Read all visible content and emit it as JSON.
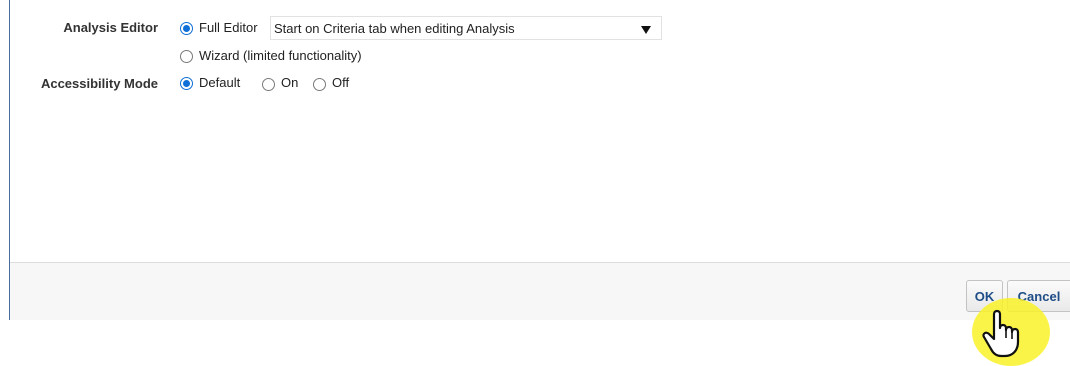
{
  "analysis_editor": {
    "label": "Analysis Editor",
    "options": [
      {
        "label": "Full Editor",
        "checked": true
      },
      {
        "label": "Wizard (limited functionality)",
        "checked": false
      }
    ],
    "start_tab_select": {
      "value": "Start on Criteria tab when editing Analysis"
    }
  },
  "accessibility_mode": {
    "label": "Accessibility Mode",
    "options": [
      {
        "label": "Default",
        "checked": true
      },
      {
        "label": "On",
        "checked": false
      },
      {
        "label": "Off",
        "checked": false
      }
    ]
  },
  "footer": {
    "ok_label": "OK",
    "cancel_label": "Cancel"
  },
  "colors": {
    "radio_selected": "#0e6fd6",
    "button_text": "#1f4d87",
    "dialog_border": "#4a6da0",
    "click_highlight": "#faf228"
  },
  "cursor": {
    "icon": "pointing-hand-icon"
  }
}
